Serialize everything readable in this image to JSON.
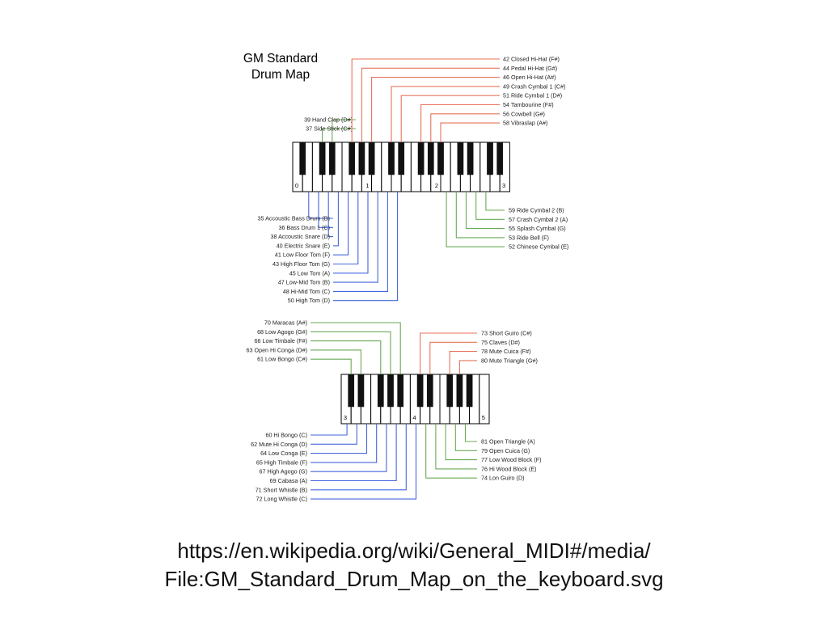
{
  "diagram": {
    "title_lines": [
      "GM Standard",
      "Drum Map"
    ],
    "colors": {
      "white_key_label_line": "#4466dd",
      "black_key_label_line": "#e8735a",
      "green_line": "#6aaa55",
      "key_outline": "#000000",
      "black_key": "#111111"
    },
    "keyboard_1": {
      "octave_labels": [
        "0",
        "1",
        "2",
        "3"
      ],
      "top_green": [
        {
          "text": "39 Hand Clap (D#)"
        },
        {
          "text": "37 Side Stick (C#)"
        }
      ],
      "top_red": [
        {
          "text": "42 Closed Hi-Hat (F#)"
        },
        {
          "text": "44 Pedal Hi-Hat (G#)"
        },
        {
          "text": "46 Open Hi-Hat (A#)"
        },
        {
          "text": "49 Crash Cymbal 1 (C#)"
        },
        {
          "text": "51 Ride Cymbal 1 (D#)"
        },
        {
          "text": "54 Tambourine (F#)"
        },
        {
          "text": "56 Cowbell (G#)"
        },
        {
          "text": "58 Vibraslap (A#)"
        }
      ],
      "bottom_blue": [
        {
          "text": "35 Accoustic Bass Drum (B)"
        },
        {
          "text": "36 Bass Drum 1 (C)"
        },
        {
          "text": "38 Accoustic Snare (D)"
        },
        {
          "text": "40 Electric Snare (E)"
        },
        {
          "text": "41 Low Floor Tom (F)"
        },
        {
          "text": "43 High Floor Tom (G)"
        },
        {
          "text": "45 Low Tom (A)"
        },
        {
          "text": "47 Low-Mid Tom (B)"
        },
        {
          "text": "48 Hi-Mid Tom (C)"
        },
        {
          "text": "50 High Tom (D)"
        }
      ],
      "bottom_green": [
        {
          "text": "59 Ride Cymbal 2 (B)"
        },
        {
          "text": "57 Crash Cymbal 2 (A)"
        },
        {
          "text": "55 Splash Cymbal (G)"
        },
        {
          "text": "53 Ride Bell (F)"
        },
        {
          "text": "52 Chinese Cymbal (E)"
        }
      ]
    },
    "keyboard_2": {
      "octave_labels": [
        "3",
        "4",
        "5"
      ],
      "top_green": [
        {
          "text": "70 Maracas (A#)"
        },
        {
          "text": "68 Low Agogo (G#)"
        },
        {
          "text": "66 Low Timbale (F#)"
        },
        {
          "text": "63 Open Hi Conga (D#)"
        },
        {
          "text": "61 Low Bongo (C#)"
        }
      ],
      "top_red": [
        {
          "text": "73 Short Guiro (C#)"
        },
        {
          "text": "75 Claves (D#)"
        },
        {
          "text": "78 Mute Cuica (F#)"
        },
        {
          "text": "80 Mute Triangle (G#)"
        }
      ],
      "bottom_blue": [
        {
          "text": "60 Hi Bongo (C)"
        },
        {
          "text": "62 Mute Hi Conga (D)"
        },
        {
          "text": "64 Low Conga (E)"
        },
        {
          "text": "65 High Timbale (F)"
        },
        {
          "text": "67 High Agogo (G)"
        },
        {
          "text": "69 Cabasa (A)"
        },
        {
          "text": "71 Short Whistle (B)"
        },
        {
          "text": "72 Long Whistle (C)"
        }
      ],
      "bottom_green": [
        {
          "text": "81 Open Triangle (A)"
        },
        {
          "text": "79 Open Cuica (G)"
        },
        {
          "text": "77 Low Wood Block (F)"
        },
        {
          "text": "76 Hi Wood Block (E)"
        },
        {
          "text": "74 Lon Guiro (D)"
        }
      ]
    }
  },
  "caption": {
    "line1": "https://en.wikipedia.org/wiki/General_MIDI#/media/",
    "line2": "File:GM_Standard_Drum_Map_on_the_keyboard.svg"
  }
}
